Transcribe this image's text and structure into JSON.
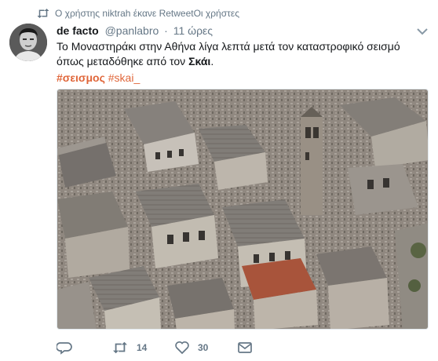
{
  "retweet_context": {
    "text": "Ο χρήστης niktrah έκανε RetweetΟι χρήστες",
    "icon": "retweet-icon"
  },
  "tweet": {
    "display_name": "de facto",
    "handle": "@panlabro",
    "dot": "·",
    "time": "11 ώρες",
    "text_part1": "Το Μοναστηράκι στην Αθήνα λίγα λεπτά μετά τον καταστροφικό σεισμό όπως μεταδόθηκε από τον ",
    "text_bold": "Σκάι",
    "text_end": ".",
    "hashtag1": "#σεισμος",
    "hashtag2": "#skai_",
    "hashtag_color": "#e0663a"
  },
  "actions": {
    "reply_icon": "reply-icon",
    "retweet_icon": "retweet-icon",
    "retweet_count": "14",
    "like_icon": "heart-icon",
    "like_count": "30",
    "dm_icon": "envelope-icon"
  }
}
